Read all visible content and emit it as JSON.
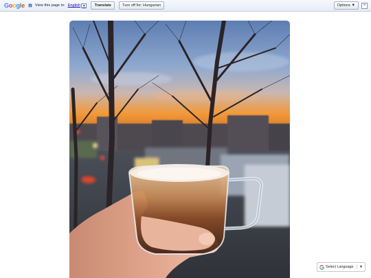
{
  "translate_bar": {
    "logo_letters": [
      "G",
      "o",
      "o",
      "g",
      "l",
      "e"
    ],
    "prompt_text": "View this page in:",
    "language_link": "English",
    "language_dropdown_glyph": "▼",
    "translate_button": "Translate",
    "turn_off_button": "Turn off for: Hungarian",
    "options_button": "Options ▼",
    "close_glyph": "×",
    "icons": {
      "translate": "translate-icon",
      "close": "close-icon"
    }
  },
  "photo": {
    "description_icon": "photo",
    "scene": "hand-holding-coffee-cup-at-sunset"
  },
  "language_widget": {
    "label": "Select Language",
    "caret": "▼",
    "icon": "google-g-icon"
  },
  "colors": {
    "bar_bg": "#e6ecf7",
    "link": "#1a0dab",
    "sunset_orange": "#f29a3a",
    "sky_blue": "#8fa9cf"
  }
}
